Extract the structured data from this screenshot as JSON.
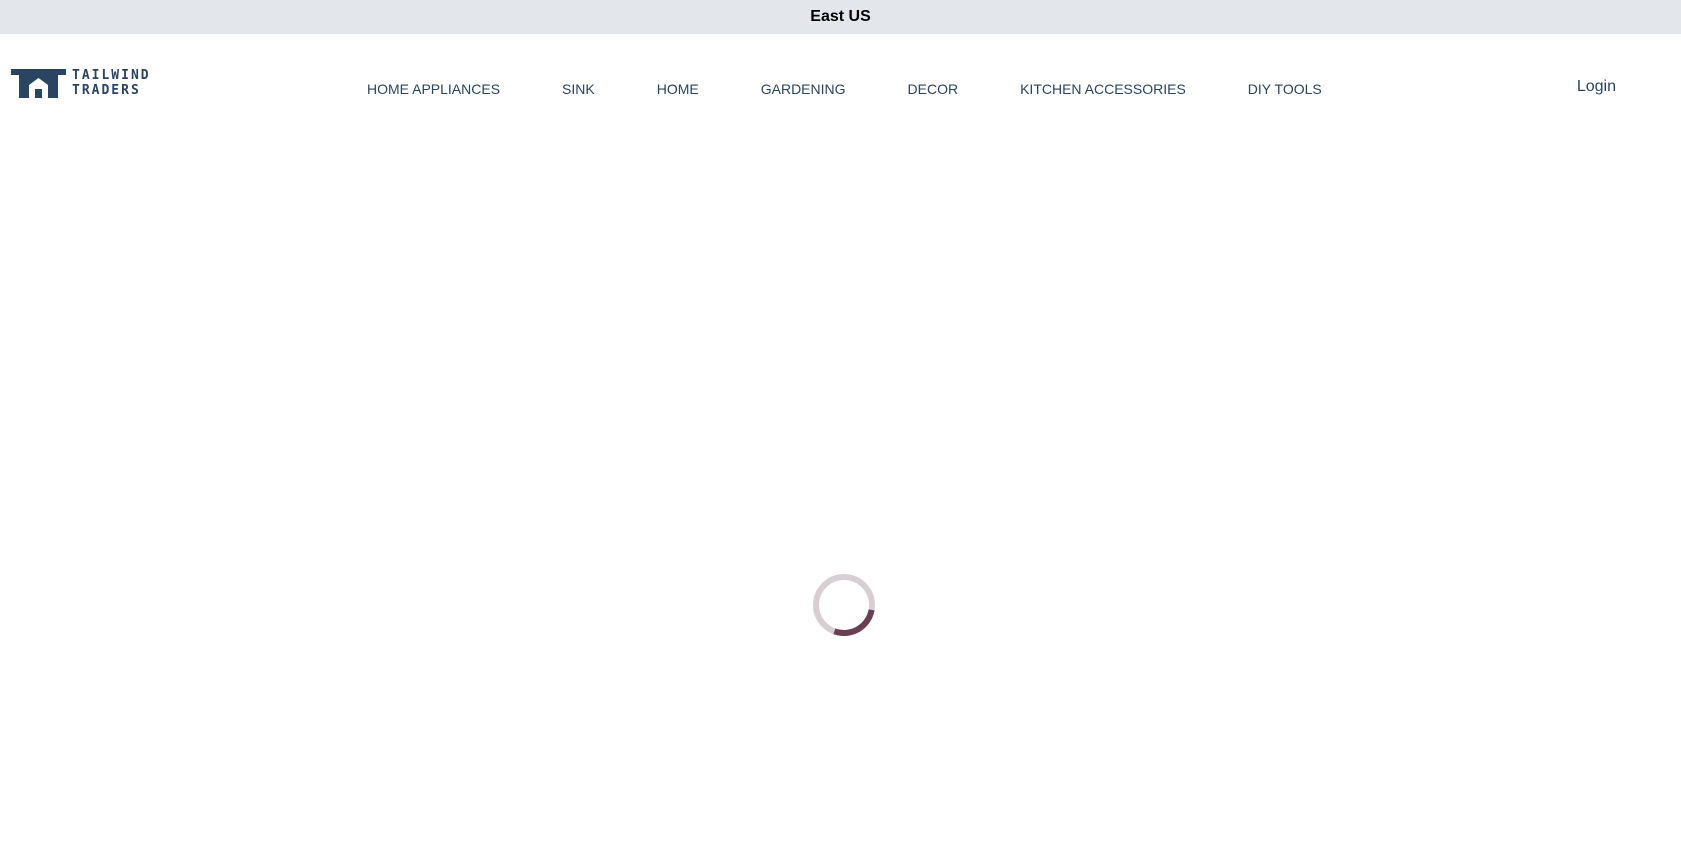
{
  "region_bar": {
    "label": "East US",
    "background": "#e3e7eb"
  },
  "header": {
    "logo": {
      "line1": "TAILWIND",
      "line2": "TRADERS",
      "color": "#2b4461"
    },
    "nav": [
      {
        "label": "HOME APPLIANCES"
      },
      {
        "label": "SINK"
      },
      {
        "label": "HOME"
      },
      {
        "label": "GARDENING"
      },
      {
        "label": "DECOR"
      },
      {
        "label": "KITCHEN ACCESSORIES"
      },
      {
        "label": "DIY TOOLS"
      }
    ],
    "login_label": "Login"
  },
  "main": {
    "loading_spinner": {
      "icon": "loading-spinner-icon",
      "track_color": "#d8cfd4",
      "arc_color": "#6b3f52"
    }
  },
  "colors": {
    "brand": "#2b4461",
    "text": "#2b4461"
  }
}
